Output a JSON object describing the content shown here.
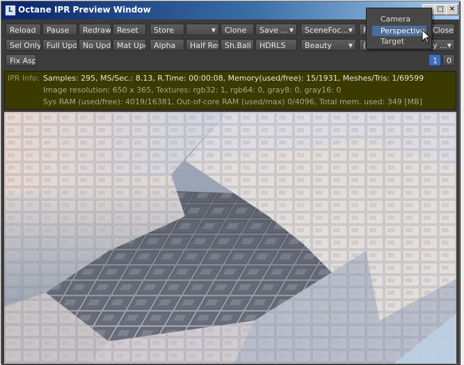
{
  "window": {
    "title": "Octane IPR Preview Window",
    "controls": {
      "minimize": "_",
      "maximize": "□",
      "close": "✕"
    },
    "icon_letter": "L"
  },
  "toolbar": {
    "row1": {
      "reload": "Reload",
      "pause": "Pause",
      "redraw": "Redraw",
      "reset": "Reset",
      "store": "Store",
      "store_slot": "",
      "clone": "Clone",
      "save": "Save ...",
      "scene_focus": "SceneFoc...",
      "hidden_f": "F",
      "close": "Close"
    },
    "row2": {
      "sel_only": "Sel Only",
      "full_upd": "Full Upd.",
      "no_upd": "No Upd.",
      "mat_upd": "Mat Upd",
      "alpha": "Alpha",
      "half_res": "Half Res",
      "sh_ball": "Sh.Ball",
      "hdrls": "HDRLS",
      "beauty": "Beauty",
      "hidden_paren": "(",
      "camera_sel": "y ...",
      "page1": "1",
      "page0": "0"
    },
    "row3": {
      "fix_asp": "Fix Asp."
    }
  },
  "camera_menu": {
    "items": [
      "Camera",
      "Perspective",
      "Target"
    ],
    "selected": "Perspective"
  },
  "ipr_info": {
    "label": "IPR Info:",
    "line1": "Samples: 295, MS/Sec.: 8.13, R.Time: 00:00:08, Memory(used/free): 15/1931, Meshes/Tris: 1/69599",
    "line2": "Image resolution: 650 x 365, Textures:  rgb32: 1, rgb64: 0, gray8: 0, gray16: 0",
    "line3": "Sys RAM (used/free): 4019/16381, Out-of-core RAM (used/max) 0/4096, Total mem. used: 349  [MB]"
  },
  "colors": {
    "title_start": "#0a246a",
    "title_end": "#a6caf0",
    "panel_bg": "#3c3c3c",
    "info_bg": "#3b3a00",
    "menu_highlight": "#4e6c98",
    "page_btn": "#3d6fb5"
  }
}
